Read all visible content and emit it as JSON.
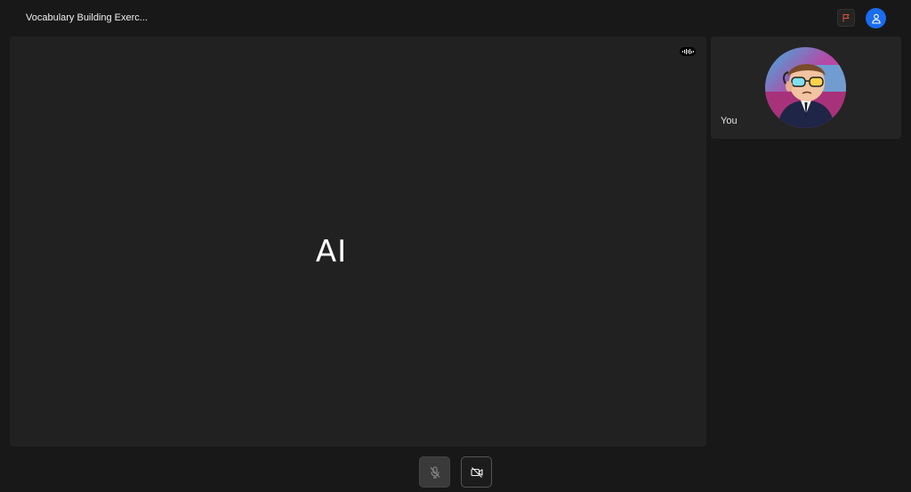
{
  "header": {
    "title": "Vocabulary Building Exerc...",
    "flag_icon": "flag-icon",
    "profile_icon": "user-icon",
    "accent_color": "#1a6cf0"
  },
  "main_tile": {
    "label": "AI",
    "indicator_icon": "audio-wave-icon"
  },
  "self_tile": {
    "label": "You",
    "avatar_icon": "avatar-image"
  },
  "controls": {
    "mic_icon": "mic-off-icon",
    "camera_icon": "camera-off-icon"
  }
}
